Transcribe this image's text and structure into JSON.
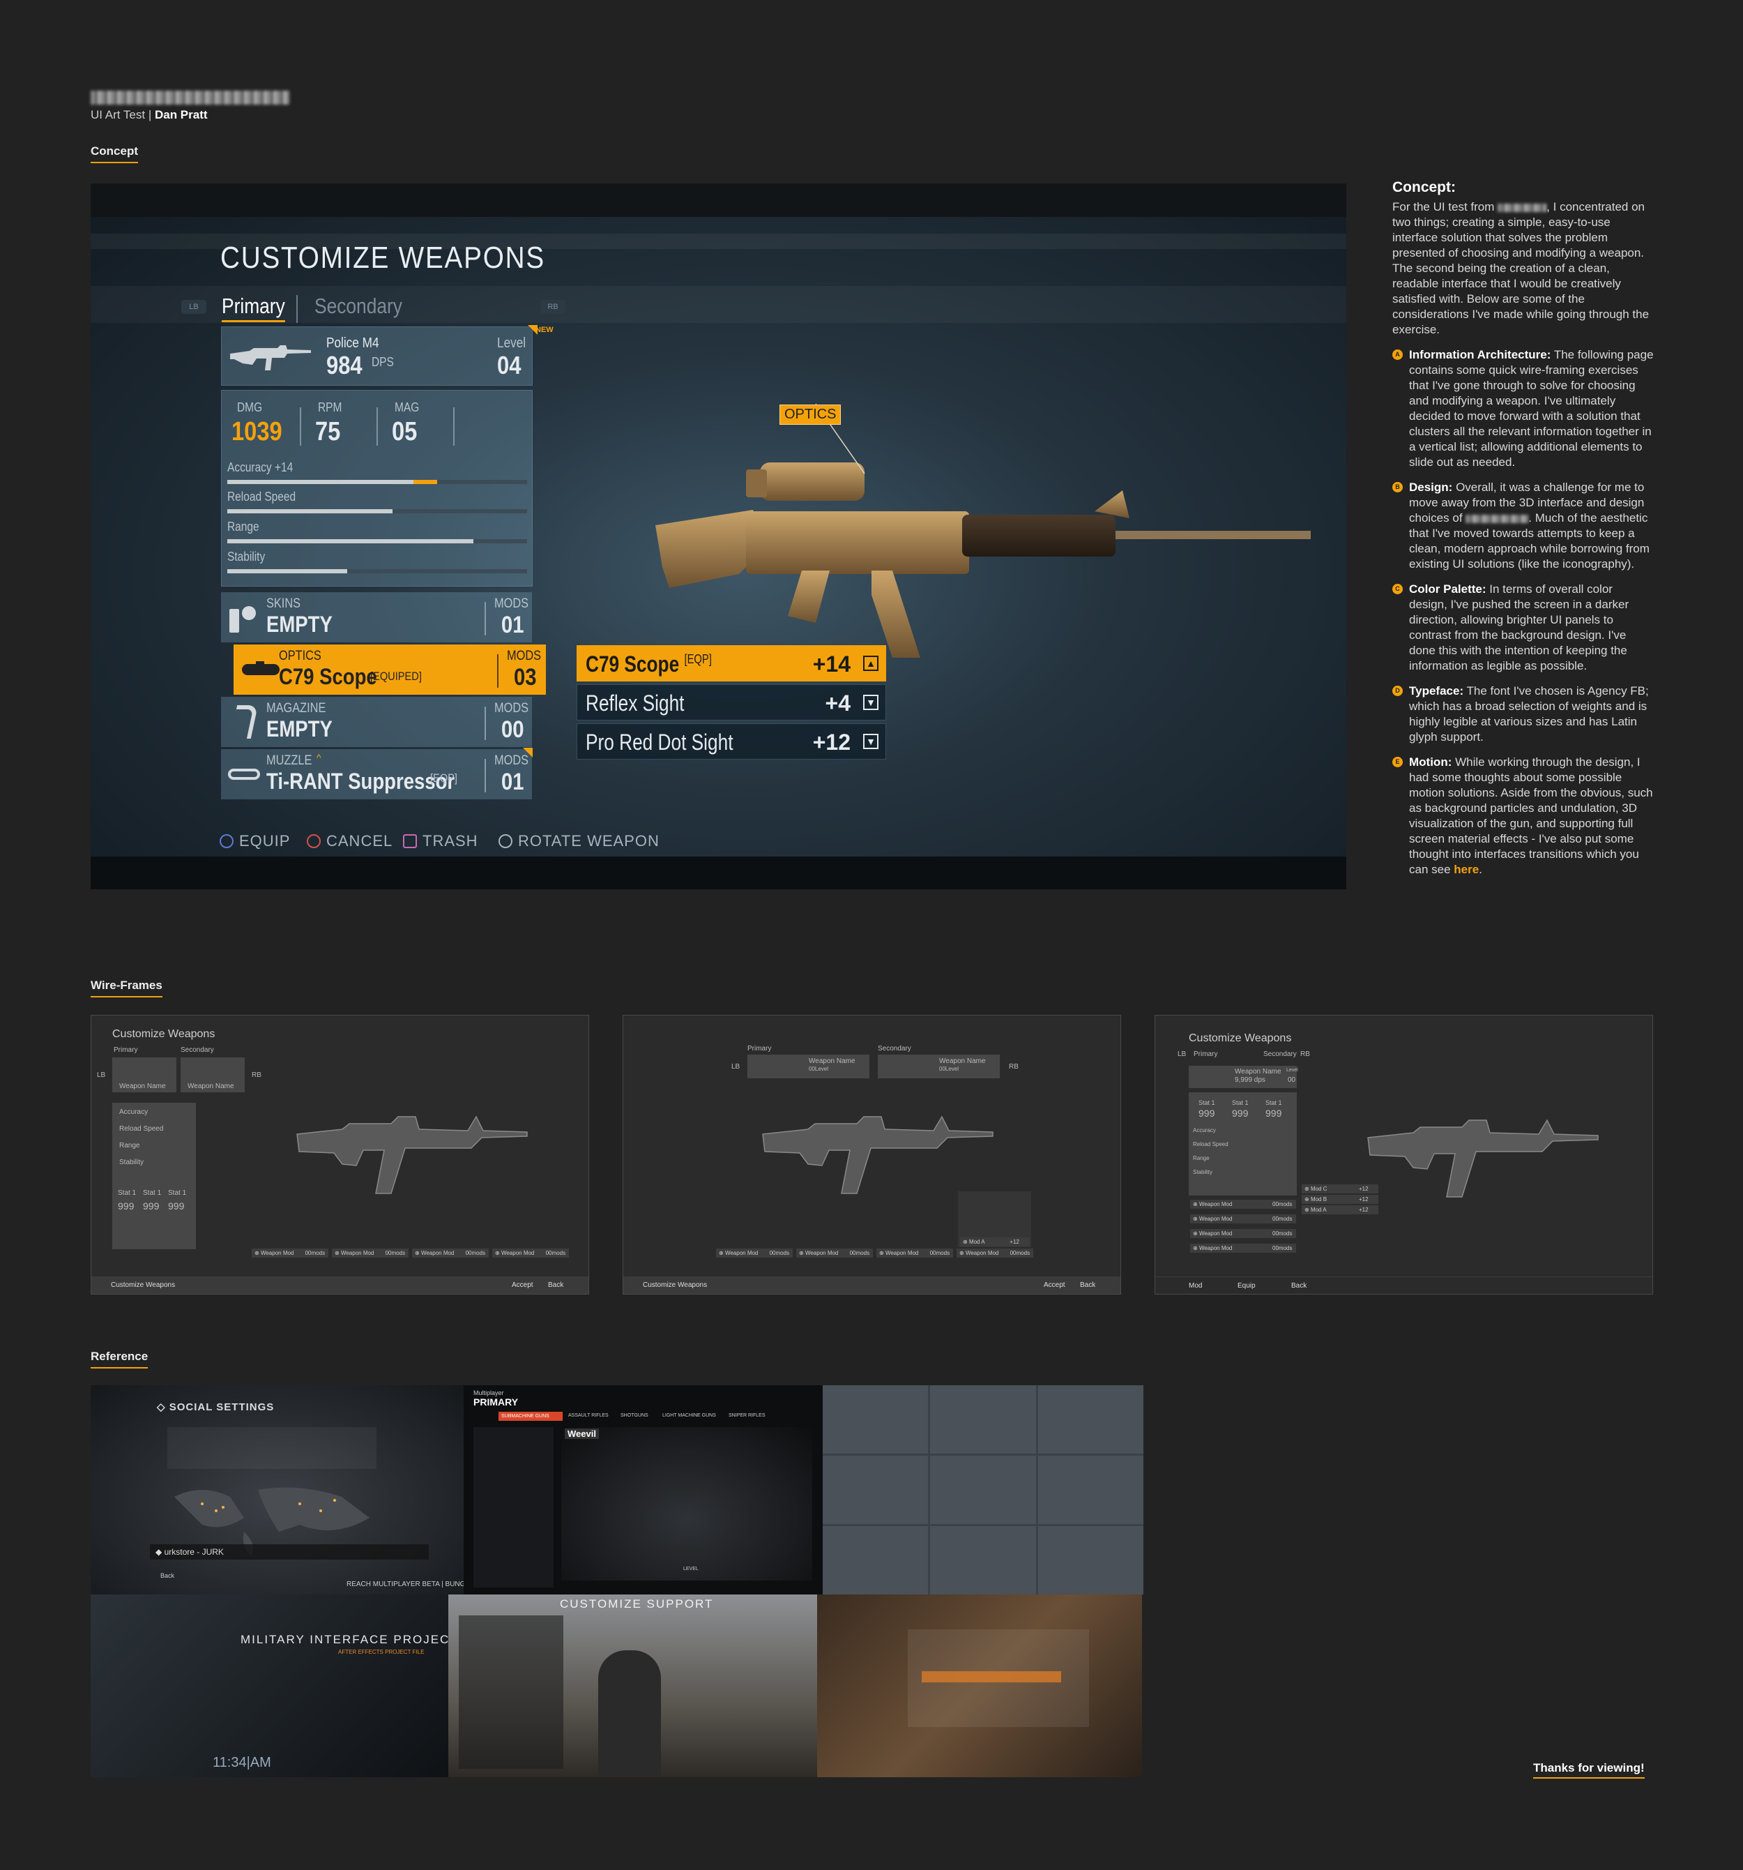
{
  "header": {
    "subtitle_prefix": "UI Art Test | ",
    "author": "Dan Pratt"
  },
  "sections": {
    "concept": "Concept",
    "wireframes": "Wire-Frames",
    "reference": "Reference"
  },
  "concept_ui": {
    "title": "CUSTOMIZE WEAPONS",
    "bumper_left": "LB",
    "bumper_right": "RB",
    "tabs": [
      {
        "label": "Primary",
        "active": true
      },
      {
        "label": "Secondary",
        "active": false
      }
    ],
    "weapon": {
      "name": "Police M4",
      "dps_value": "984",
      "dps_unit": "DPS",
      "level_label": "Level",
      "level_value": "04",
      "new_badge": "NEW"
    },
    "stats": [
      {
        "label": "DMG",
        "value": "1039",
        "highlight": true
      },
      {
        "label": "RPM",
        "value": "75",
        "highlight": false
      },
      {
        "label": "MAG",
        "value": "05",
        "highlight": false
      }
    ],
    "bars": [
      {
        "label": "Accuracy",
        "bonus": "+14",
        "level": 0.62,
        "bonus_level": 0.08
      },
      {
        "label": "Reload Speed",
        "bonus": "",
        "level": 0.55,
        "bonus_level": 0
      },
      {
        "label": "Range",
        "bonus": "",
        "level": 0.82,
        "bonus_level": 0
      },
      {
        "label": "Stability",
        "bonus": "",
        "level": 0.4,
        "bonus_level": 0
      }
    ],
    "slots": [
      {
        "category": "SKINS",
        "value": "EMPTY",
        "tag": "",
        "mods_label": "MODS",
        "mods_value": "01",
        "selected": false
      },
      {
        "category": "OPTICS",
        "value": "C79 Scope",
        "tag": "[EQUIPED]",
        "mods_label": "MODS",
        "mods_value": "03",
        "selected": true
      },
      {
        "category": "MAGAZINE",
        "value": "EMPTY",
        "tag": "",
        "mods_label": "MODS",
        "mods_value": "00",
        "selected": false
      },
      {
        "category": "MUZZLE",
        "value": "Ti-RANT Suppressor",
        "tag": "[EQP]",
        "mods_label": "MODS",
        "mods_value": "01",
        "selected": false
      }
    ],
    "options": [
      {
        "name": "C79 Scope",
        "tag": "[EQP]",
        "value": "+14",
        "selected": true
      },
      {
        "name": "Reflex Sight",
        "tag": "",
        "value": "+4",
        "selected": false
      },
      {
        "name": "Pro Red Dot Sight",
        "tag": "",
        "value": "+12",
        "selected": false
      }
    ],
    "callout": "OPTICS",
    "hints": [
      {
        "label": "EQUIP",
        "color": "#5d7ad6"
      },
      {
        "label": "CANCEL",
        "color": "#d0524e"
      },
      {
        "label": "TRASH",
        "color": "#c86ab0"
      },
      {
        "label": "ROTATE WEAPON",
        "color": "#a8b4bc"
      }
    ],
    "colors": {
      "accent": "#f4a20c"
    }
  },
  "concept_text": {
    "heading": "Concept:",
    "intro_a": "For the UI test from",
    "intro_b": ", I concentrated on two things; creating a simple, easy-to-use interface solution that solves the problem presented of choosing and modifying a weapon. The second being the creation of a clean, readable interface that I would be creatively satisfied with. Below are some of the considerations I've made while going through the exercise.",
    "points": [
      {
        "letter": "A",
        "title": "Information Architecture:",
        "body": "The following page contains some quick wire-framing exercises that I've gone through to solve for choosing and modifying a weapon. I've ultimately decided to move forward with a solution that clusters all the relevant information together in a vertical list; allowing additional elements to slide out as needed."
      },
      {
        "letter": "B",
        "title": "Design:",
        "body_a": "Overall, it was a challenge for me to move away from the 3D interface and design choices of",
        "body": ". Much of the aesthetic that I've moved towards attempts to keep a clean, modern approach while borrowing from existing UI solutions (like the iconography)."
      },
      {
        "letter": "C",
        "title": "Color Palette:",
        "body": "In terms of overall color design, I've pushed the screen in a darker direction, allowing brighter UI panels to contrast from the background design. I've done this with the intention of keeping the information as legible as possible."
      },
      {
        "letter": "D",
        "title": "Typeface:",
        "body": "The font I've chosen is Agency FB; which has a broad selection of weights and is highly legible at various sizes and has Latin glyph support."
      },
      {
        "letter": "E",
        "title": "Motion:",
        "body": "While working through the design, I had some thoughts about some possible motion solutions. Aside from the obvious, such as background particles and undulation, 3D visualization of the gun, and supporting full screen material effects - I've also put some thought into interfaces transitions which you can see",
        "link": "here"
      }
    ]
  },
  "wireframes": {
    "wf1": {
      "title": "Customize Weapons",
      "primary": "Primary",
      "secondary": "Secondary",
      "lb": "LB",
      "rb": "RB",
      "weapon_name": "Weapon Name",
      "bars": [
        "Accuracy",
        "Reload Speed",
        "Range",
        "Stability"
      ],
      "stat_label": "Stat 1",
      "stat_value": "999",
      "mod": "Weapon Mod",
      "mod_val": "00mods",
      "footer": "Customize Weapons",
      "accept": "Accept",
      "back": "Back"
    },
    "wf2": {
      "primary": "Primary",
      "secondary": "Secondary",
      "lb": "LB",
      "rb": "RB",
      "weapon_name": "Weapon Name",
      "level": "00Level",
      "mod": "Weapon Mod",
      "mod_val": "00mods",
      "mod_a": "Mod A",
      "mod_a_val": "+12",
      "footer": "Customize Weapons",
      "accept": "Accept",
      "back": "Back"
    },
    "wf3": {
      "title": "Customize Weapons",
      "primary": "Primary",
      "secondary": "Secondary",
      "lb": "LB",
      "rb": "RB",
      "weapon_name": "Weapon Name",
      "dps": "9,999 dps",
      "level_label": "Level",
      "level": "00",
      "stat_label": "Stat 1",
      "stat_value": "999",
      "bars": [
        "Accuracy",
        "Reload Speed",
        "Range",
        "Stability"
      ],
      "mod": "Weapon Mod",
      "mod_val": "00mods",
      "mods_sub": [
        "Mod C",
        "Mod B",
        "Mod A"
      ],
      "mod_sub_val": "+12",
      "f1": "Mod",
      "f2": "Equip",
      "f3": "Back"
    }
  },
  "reference": {
    "r1_title": "SOCIAL SETTINGS",
    "r1_user": "urkstore - JURK",
    "r1_footer": "REACH MULTIPLAYER BETA | BUNGIE",
    "r1_back": "Back",
    "r2_sub": "Multiplayer",
    "r2_title": "PRIMARY",
    "r2_tabs": [
      "SUBMACHINE GUNS",
      "ASSAULT RIFLES",
      "SHOTGUNS",
      "LIGHT MACHINE GUNS",
      "SNIPER RIFLES"
    ],
    "r2_weapon": "Weevil",
    "r2_level": "LEVEL",
    "r4_title": "MILITARY INTERFACE PROJECT",
    "r4_sub": "AFTER EFFECTS PROJECT FILE",
    "r4_time": "11:34|AM",
    "r5_title": "CUSTOMIZE SUPPORT"
  },
  "footer": {
    "thanks": "Thanks for viewing!"
  }
}
